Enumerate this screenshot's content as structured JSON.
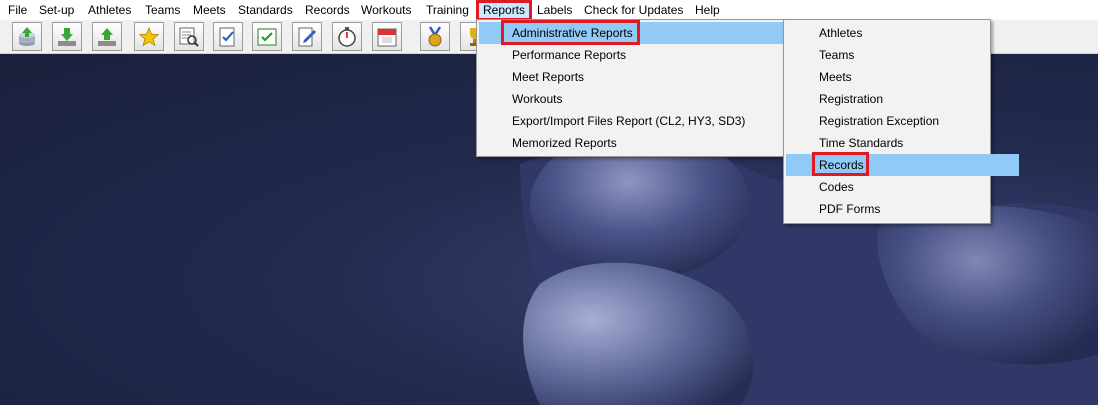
{
  "menubar": {
    "items": [
      "File",
      "Set-up",
      "Athletes",
      "Teams",
      "Meets",
      "Standards",
      "Records",
      "Workouts",
      "Training",
      "Reports",
      "Labels",
      "Check for Updates",
      "Help"
    ],
    "active": "Reports"
  },
  "toolbar": {
    "buttons": [
      "database-upload-icon",
      "download-icon",
      "export-icon",
      "star-icon",
      "search-list-icon",
      "checklist-icon",
      "checked-calendar-icon",
      "document-edit-icon",
      "stopwatch-icon",
      "calendar-icon",
      "medal-icon",
      "trophy-icon"
    ]
  },
  "reports_menu": {
    "items": [
      {
        "label": "Administrative Reports",
        "submenu": true
      },
      {
        "label": "Performance Reports",
        "submenu": true
      },
      {
        "label": "Meet Reports",
        "submenu": true
      },
      {
        "label": "Workouts",
        "submenu": true
      },
      {
        "label": "Export/Import Files Report (CL2, HY3, SD3)",
        "submenu": false
      },
      {
        "label": "Memorized Reports",
        "submenu": false
      }
    ],
    "highlighted": "Administrative Reports"
  },
  "administrative_submenu": {
    "items": [
      "Athletes",
      "Teams",
      "Meets",
      "Registration",
      "Registration Exception",
      "Time Standards",
      "Records",
      "Codes",
      "PDF Forms"
    ],
    "highlighted": "Records"
  },
  "annotation_color": "#e01a24",
  "submenu_arrow": "›"
}
